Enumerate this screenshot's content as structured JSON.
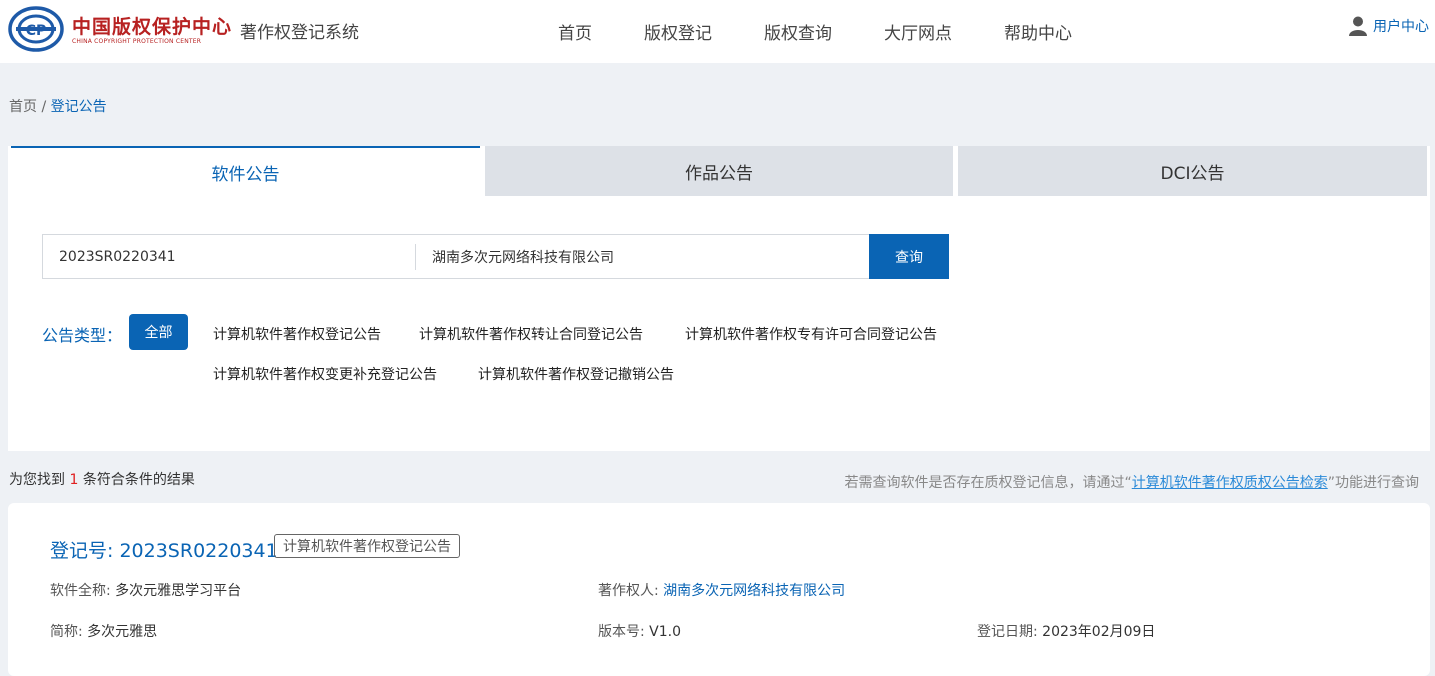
{
  "header": {
    "logo_cn": "中国版权保护中心",
    "logo_en": "CHINA COPYRIGHT PROTECTION CENTER",
    "system_name": "著作权登记系统",
    "nav": [
      "首页",
      "版权登记",
      "版权查询",
      "大厅网点",
      "帮助中心"
    ],
    "user_label": "用户中心",
    "brand_color": "#b72121",
    "accent_color": "#0a64b4"
  },
  "breadcrumb": {
    "home": "首页",
    "separator": "/",
    "current": "登记公告"
  },
  "tabs": [
    "软件公告",
    "作品公告",
    "DCI公告"
  ],
  "search": {
    "reg_no_value": "2023SR0220341",
    "owner_value": "湖南多次元网络科技有限公司",
    "button": "查询"
  },
  "filter": {
    "label": "公告类型：",
    "all": "全部",
    "items": [
      "计算机软件著作权登记公告",
      "计算机软件著作权转让合同登记公告",
      "计算机软件著作权专有许可合同登记公告",
      "计算机软件著作权变更补充登记公告",
      "计算机软件著作权登记撤销公告"
    ]
  },
  "results": {
    "prefix": "为您找到",
    "count": "1",
    "suffix": "条符合条件的结果",
    "hint_prefix": "若需查询软件是否存在质权登记信息，请通过“",
    "hint_link": "计算机软件著作权质权公告检索",
    "hint_suffix": "”功能进行查询"
  },
  "record": {
    "reg_label": "登记号: ",
    "reg_no": "2023SR0220341",
    "tag": "计算机软件著作权登记公告",
    "full_name_label": "软件全称: ",
    "full_name": "多次元雅思学习平台",
    "owner_label": "著作权人: ",
    "owner": "湖南多次元网络科技有限公司",
    "short_label": "简称: ",
    "short_name": "多次元雅思",
    "version_label": "版本号: ",
    "version": "V1.0",
    "date_label": "登记日期: ",
    "date": "2023年02月09日"
  }
}
